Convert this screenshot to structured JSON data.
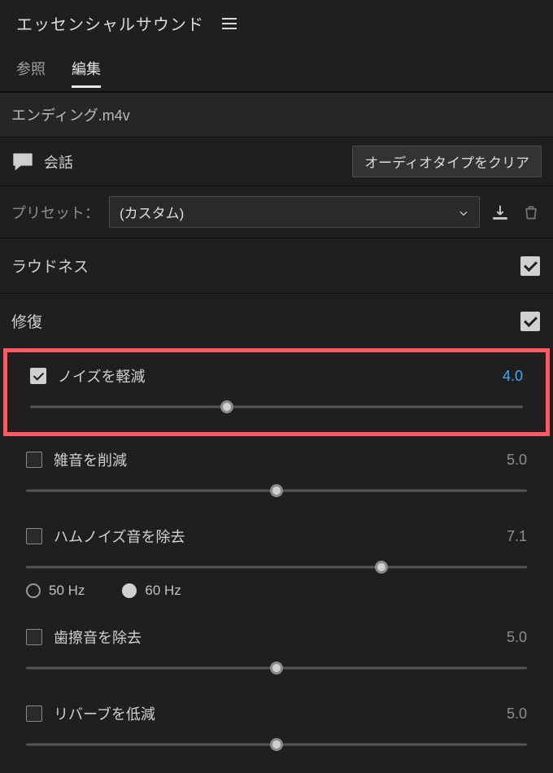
{
  "panel": {
    "title": "エッセンシャルサウンド"
  },
  "tabs": {
    "browse": "参照",
    "edit": "編集"
  },
  "clip": {
    "name": "エンディング.m4v"
  },
  "audiotype": {
    "label": "会話",
    "clear_button": "オーディオタイプをクリア"
  },
  "preset": {
    "label": "プリセット：",
    "value": "(カスタム)"
  },
  "sections": {
    "loudness": {
      "title": "ラウドネス"
    },
    "repair": {
      "title": "修復"
    }
  },
  "repair": {
    "reduce_noise": {
      "label": "ノイズを軽減",
      "value": "4.0",
      "pos": 40
    },
    "reduce_rumble": {
      "label": "雑音を削減",
      "value": "5.0",
      "pos": 50
    },
    "dehum": {
      "label": "ハムノイズ音を除去",
      "value": "7.1",
      "pos": 71
    },
    "deess": {
      "label": "歯擦音を除去",
      "value": "5.0",
      "pos": 50
    },
    "dereverb": {
      "label": "リバーブを低減",
      "value": "5.0",
      "pos": 50
    },
    "hz50": "50 Hz",
    "hz60": "60 Hz"
  }
}
